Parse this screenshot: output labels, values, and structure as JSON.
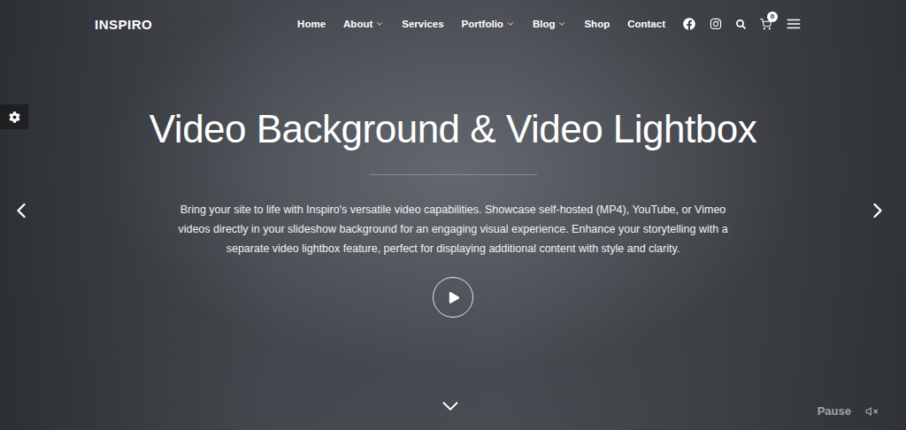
{
  "header": {
    "logo": "INSPIRO",
    "nav": [
      {
        "label": "Home",
        "submenu": false
      },
      {
        "label": "About",
        "submenu": true
      },
      {
        "label": "Services",
        "submenu": false
      },
      {
        "label": "Portfolio",
        "submenu": true
      },
      {
        "label": "Blog",
        "submenu": true
      },
      {
        "label": "Shop",
        "submenu": false
      },
      {
        "label": "Contact",
        "submenu": false
      }
    ],
    "cart_count": "0"
  },
  "hero": {
    "title": "Video Background & Video Lightbox",
    "description": "Bring your site to life with Inspiro's versatile video capabilities. Showcase self-hosted (MP4), YouTube, or Vimeo videos directly in your slideshow background for an engaging visual experience. Enhance your storytelling with a separate video lightbox feature, perfect for displaying additional content with style and clarity."
  },
  "video_controls": {
    "pause_label": "Pause",
    "muted": true
  }
}
